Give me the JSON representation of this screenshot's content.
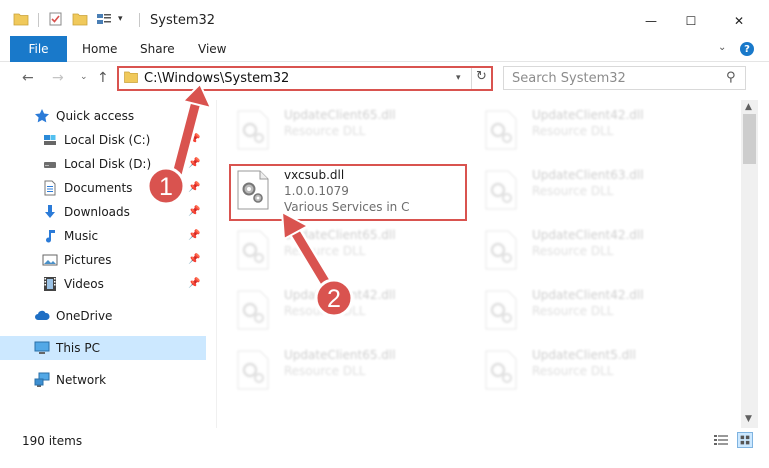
{
  "window": {
    "title": "System32",
    "controls": {
      "minimize": "—",
      "maximize": "☐",
      "close": "✕"
    }
  },
  "ribbon": {
    "tabs": [
      "File",
      "Home",
      "Share",
      "View"
    ],
    "help": "?",
    "expand": "⌄"
  },
  "nav": {
    "back": "←",
    "forward": "→",
    "recent": "⌄",
    "up": "↑",
    "address": "C:\\Windows\\System32",
    "refresh": "↻",
    "search_placeholder": "Search System32",
    "search_icon": "⚲"
  },
  "sidebar": {
    "items": [
      {
        "label": "Quick access",
        "icon": "star-icon",
        "pinned": false
      },
      {
        "label": "Local Disk (C:)",
        "icon": "drive-icon",
        "pinned": true
      },
      {
        "label": "Local Disk (D:)",
        "icon": "drive-icon",
        "pinned": true
      },
      {
        "label": "Documents",
        "icon": "documents-icon",
        "pinned": true
      },
      {
        "label": "Downloads",
        "icon": "downloads-icon",
        "pinned": true
      },
      {
        "label": "Music",
        "icon": "music-icon",
        "pinned": true
      },
      {
        "label": "Pictures",
        "icon": "pictures-icon",
        "pinned": true
      },
      {
        "label": "Videos",
        "icon": "videos-icon",
        "pinned": true
      },
      {
        "label": "OneDrive",
        "icon": "onedrive-icon",
        "pinned": false
      },
      {
        "label": "This PC",
        "icon": "pc-icon",
        "pinned": false,
        "selected": true
      },
      {
        "label": "Network",
        "icon": "network-icon",
        "pinned": false
      }
    ],
    "pin_glyph": "📌"
  },
  "files": {
    "left": [
      {
        "name": "UpdateClient65.dll",
        "type": "Resource DLL"
      },
      {
        "name": "vxcsub.dll",
        "type": "1.0.0.1079",
        "desc": "Various Services in C",
        "highlight": true
      },
      {
        "name": "UpdateClient65.dll",
        "type": "Resource DLL"
      },
      {
        "name": "UpdateClient42.dll",
        "type": "Resource DLL"
      },
      {
        "name": "UpdateClient65.dll",
        "type": "Resource DLL"
      }
    ],
    "right": [
      {
        "name": "UpdateClient42.dll",
        "type": "Resource DLL"
      },
      {
        "name": "UpdateClient63.dll",
        "type": "Resource DLL"
      },
      {
        "name": "UpdateClient42.dll",
        "type": "Resource DLL"
      },
      {
        "name": "UpdateClient42.dll",
        "type": "Resource DLL"
      },
      {
        "name": "UpdateClient5.dll",
        "type": "Resource DLL"
      }
    ]
  },
  "annotations": {
    "step1": "1",
    "step2": "2",
    "color": "#d9534f"
  },
  "status": {
    "items": "190 items"
  },
  "scroll": {
    "up": "▲",
    "down": "▼"
  }
}
